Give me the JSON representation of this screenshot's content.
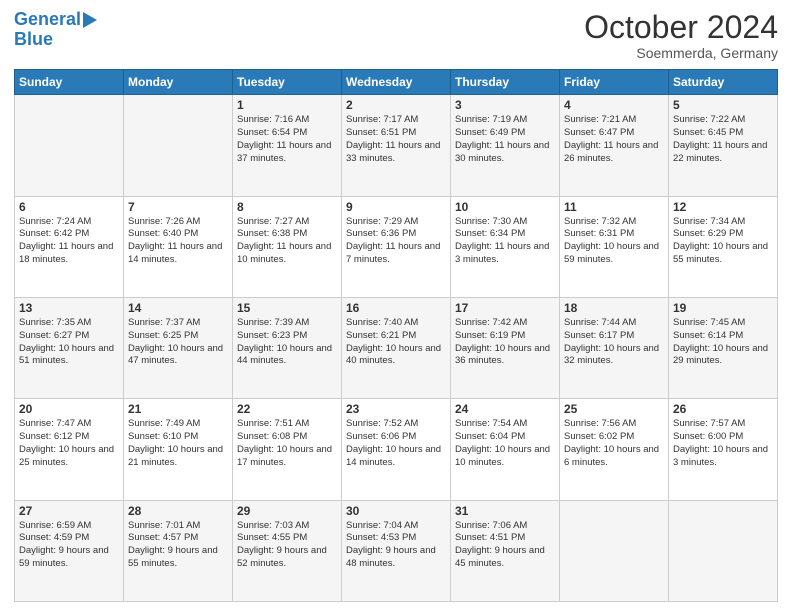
{
  "logo": {
    "line1": "General",
    "line2": "Blue"
  },
  "header": {
    "month": "October 2024",
    "location": "Soemmerda, Germany"
  },
  "weekdays": [
    "Sunday",
    "Monday",
    "Tuesday",
    "Wednesday",
    "Thursday",
    "Friday",
    "Saturday"
  ],
  "weeks": [
    [
      {
        "day": "",
        "info": ""
      },
      {
        "day": "",
        "info": ""
      },
      {
        "day": "1",
        "info": "Sunrise: 7:16 AM\nSunset: 6:54 PM\nDaylight: 11 hours and 37 minutes."
      },
      {
        "day": "2",
        "info": "Sunrise: 7:17 AM\nSunset: 6:51 PM\nDaylight: 11 hours and 33 minutes."
      },
      {
        "day": "3",
        "info": "Sunrise: 7:19 AM\nSunset: 6:49 PM\nDaylight: 11 hours and 30 minutes."
      },
      {
        "day": "4",
        "info": "Sunrise: 7:21 AM\nSunset: 6:47 PM\nDaylight: 11 hours and 26 minutes."
      },
      {
        "day": "5",
        "info": "Sunrise: 7:22 AM\nSunset: 6:45 PM\nDaylight: 11 hours and 22 minutes."
      }
    ],
    [
      {
        "day": "6",
        "info": "Sunrise: 7:24 AM\nSunset: 6:42 PM\nDaylight: 11 hours and 18 minutes."
      },
      {
        "day": "7",
        "info": "Sunrise: 7:26 AM\nSunset: 6:40 PM\nDaylight: 11 hours and 14 minutes."
      },
      {
        "day": "8",
        "info": "Sunrise: 7:27 AM\nSunset: 6:38 PM\nDaylight: 11 hours and 10 minutes."
      },
      {
        "day": "9",
        "info": "Sunrise: 7:29 AM\nSunset: 6:36 PM\nDaylight: 11 hours and 7 minutes."
      },
      {
        "day": "10",
        "info": "Sunrise: 7:30 AM\nSunset: 6:34 PM\nDaylight: 11 hours and 3 minutes."
      },
      {
        "day": "11",
        "info": "Sunrise: 7:32 AM\nSunset: 6:31 PM\nDaylight: 10 hours and 59 minutes."
      },
      {
        "day": "12",
        "info": "Sunrise: 7:34 AM\nSunset: 6:29 PM\nDaylight: 10 hours and 55 minutes."
      }
    ],
    [
      {
        "day": "13",
        "info": "Sunrise: 7:35 AM\nSunset: 6:27 PM\nDaylight: 10 hours and 51 minutes."
      },
      {
        "day": "14",
        "info": "Sunrise: 7:37 AM\nSunset: 6:25 PM\nDaylight: 10 hours and 47 minutes."
      },
      {
        "day": "15",
        "info": "Sunrise: 7:39 AM\nSunset: 6:23 PM\nDaylight: 10 hours and 44 minutes."
      },
      {
        "day": "16",
        "info": "Sunrise: 7:40 AM\nSunset: 6:21 PM\nDaylight: 10 hours and 40 minutes."
      },
      {
        "day": "17",
        "info": "Sunrise: 7:42 AM\nSunset: 6:19 PM\nDaylight: 10 hours and 36 minutes."
      },
      {
        "day": "18",
        "info": "Sunrise: 7:44 AM\nSunset: 6:17 PM\nDaylight: 10 hours and 32 minutes."
      },
      {
        "day": "19",
        "info": "Sunrise: 7:45 AM\nSunset: 6:14 PM\nDaylight: 10 hours and 29 minutes."
      }
    ],
    [
      {
        "day": "20",
        "info": "Sunrise: 7:47 AM\nSunset: 6:12 PM\nDaylight: 10 hours and 25 minutes."
      },
      {
        "day": "21",
        "info": "Sunrise: 7:49 AM\nSunset: 6:10 PM\nDaylight: 10 hours and 21 minutes."
      },
      {
        "day": "22",
        "info": "Sunrise: 7:51 AM\nSunset: 6:08 PM\nDaylight: 10 hours and 17 minutes."
      },
      {
        "day": "23",
        "info": "Sunrise: 7:52 AM\nSunset: 6:06 PM\nDaylight: 10 hours and 14 minutes."
      },
      {
        "day": "24",
        "info": "Sunrise: 7:54 AM\nSunset: 6:04 PM\nDaylight: 10 hours and 10 minutes."
      },
      {
        "day": "25",
        "info": "Sunrise: 7:56 AM\nSunset: 6:02 PM\nDaylight: 10 hours and 6 minutes."
      },
      {
        "day": "26",
        "info": "Sunrise: 7:57 AM\nSunset: 6:00 PM\nDaylight: 10 hours and 3 minutes."
      }
    ],
    [
      {
        "day": "27",
        "info": "Sunrise: 6:59 AM\nSunset: 4:59 PM\nDaylight: 9 hours and 59 minutes."
      },
      {
        "day": "28",
        "info": "Sunrise: 7:01 AM\nSunset: 4:57 PM\nDaylight: 9 hours and 55 minutes."
      },
      {
        "day": "29",
        "info": "Sunrise: 7:03 AM\nSunset: 4:55 PM\nDaylight: 9 hours and 52 minutes."
      },
      {
        "day": "30",
        "info": "Sunrise: 7:04 AM\nSunset: 4:53 PM\nDaylight: 9 hours and 48 minutes."
      },
      {
        "day": "31",
        "info": "Sunrise: 7:06 AM\nSunset: 4:51 PM\nDaylight: 9 hours and 45 minutes."
      },
      {
        "day": "",
        "info": ""
      },
      {
        "day": "",
        "info": ""
      }
    ]
  ]
}
